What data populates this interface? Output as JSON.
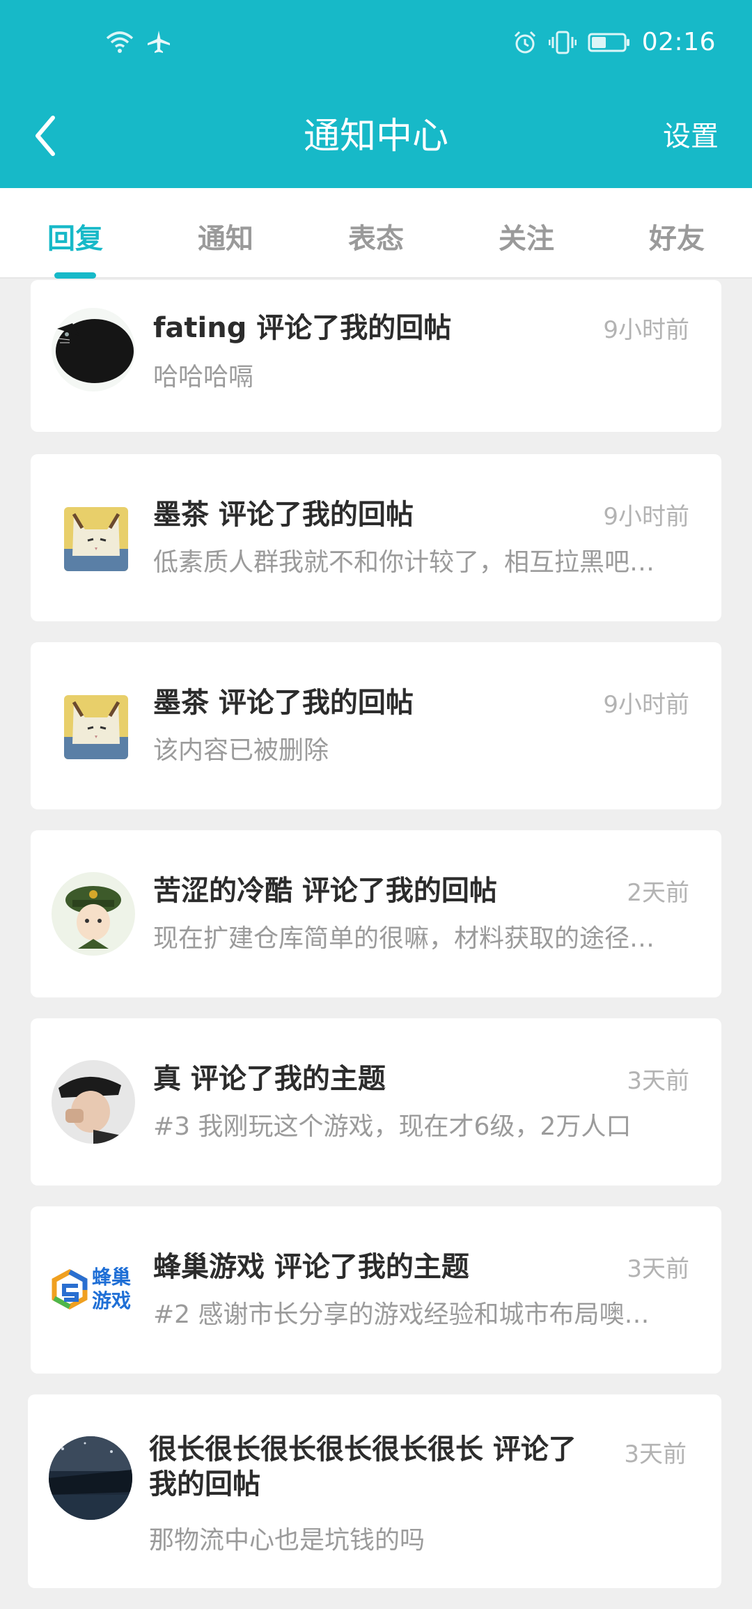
{
  "status_bar": {
    "time": "02:16",
    "left_icons": [
      "wifi-icon",
      "airplane-icon"
    ],
    "right_icons": [
      "alarm-icon",
      "vibrate-icon",
      "battery-icon"
    ]
  },
  "navbar": {
    "title": "通知中心",
    "settings_label": "设置"
  },
  "tabs": [
    {
      "label": "回复",
      "active": true
    },
    {
      "label": "通知",
      "active": false
    },
    {
      "label": "表态",
      "active": false
    },
    {
      "label": "关注",
      "active": false
    },
    {
      "label": "好友",
      "active": false
    }
  ],
  "notifications": [
    {
      "title": "fating 评论了我的回帖",
      "body": "哈哈哈嗝",
      "time": "9小时前",
      "avatar": "black-cat-avatar"
    },
    {
      "title": "墨茶 评论了我的回帖",
      "body": "低素质人群我就不和你计较了，相互拉黑吧…",
      "time": "9小时前",
      "avatar": "cat-avatar"
    },
    {
      "title": "墨茶 评论了我的回帖",
      "body": "该内容已被删除",
      "time": "9小时前",
      "avatar": "cat-avatar"
    },
    {
      "title": "苦涩的冷酷 评论了我的回帖",
      "body": "现在扩建仓库简单的很嘛，材料获取的途径…",
      "time": "2天前",
      "avatar": "officer-avatar"
    },
    {
      "title": "真 评论了我的主题",
      "body": "#3 我刚玩这个游戏，现在才6级，2万人口",
      "time": "3天前",
      "avatar": "person-avatar"
    },
    {
      "title": "蜂巢游戏 评论了我的主题",
      "body": "#2 感谢市长分享的游戏经验和城市布局噢…",
      "time": "3天前",
      "avatar": "fengchao-logo",
      "logo_text_top": "蜂巢",
      "logo_text_bottom": "游戏"
    },
    {
      "title_line1": "很长很长很长很长很长很长 评论了",
      "title_line2": "我的回帖",
      "body": "那物流中心也是坑钱的吗",
      "time": "3天前",
      "avatar": "night-scene-avatar"
    }
  ],
  "colors": {
    "accent": "#17b9c8",
    "background": "#efefef",
    "card": "#ffffff"
  }
}
